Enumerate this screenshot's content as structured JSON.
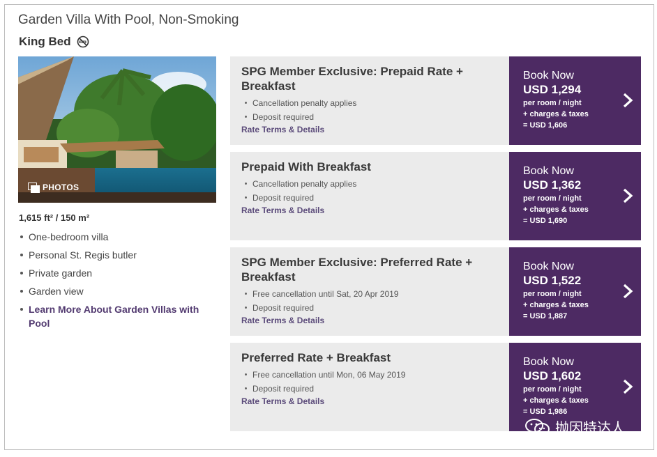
{
  "room": {
    "title": "Garden Villa With Pool, Non-Smoking",
    "bed": "King Bed",
    "photos_label": "PHOTOS",
    "size": "1,615 ft² / 150 m²",
    "features": [
      "One-bedroom villa",
      "Personal St. Regis butler",
      "Private garden",
      "Garden view"
    ],
    "learn_more": "Learn More About Garden Villas with Pool"
  },
  "rates": [
    {
      "name": "SPG Member Exclusive: Prepaid Rate + Breakfast",
      "bullets": [
        "Cancellation penalty applies",
        "Deposit required"
      ],
      "terms": "Rate Terms & Details",
      "book": "Book Now",
      "price": "USD 1,294",
      "per": "per room / night",
      "charges": "+ charges & taxes",
      "total": "= USD 1,606"
    },
    {
      "name": "Prepaid With Breakfast",
      "bullets": [
        "Cancellation penalty applies",
        "Deposit required"
      ],
      "terms": "Rate Terms & Details",
      "book": "Book Now",
      "price": "USD 1,362",
      "per": "per room / night",
      "charges": "+ charges & taxes",
      "total": "= USD 1,690"
    },
    {
      "name": "SPG Member Exclusive: Preferred Rate + Breakfast",
      "bullets": [
        "Free cancellation until Sat, 20 Apr 2019",
        "Deposit required"
      ],
      "terms": "Rate Terms & Details",
      "book": "Book Now",
      "price": "USD 1,522",
      "per": "per room / night",
      "charges": "+ charges & taxes",
      "total": "= USD 1,887"
    },
    {
      "name": "Preferred Rate + Breakfast",
      "bullets": [
        "Free cancellation until Mon, 06 May 2019",
        "Deposit required"
      ],
      "terms": "Rate Terms & Details",
      "book": "Book Now",
      "price": "USD 1,602",
      "per": "per room / night",
      "charges": "+ charges & taxes",
      "total": "= USD 1,986"
    }
  ],
  "watermark": "抛因特达人",
  "colors": {
    "accent": "#4d2a63",
    "link": "#523a70",
    "card_bg": "#ebebeb"
  },
  "icons": {
    "bed_note": "no-smoking-icon",
    "book": "chevron-right-icon",
    "photos": "photos-icon"
  }
}
